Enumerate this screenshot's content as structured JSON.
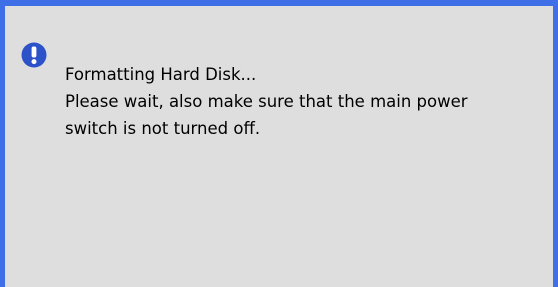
{
  "dialog": {
    "icon": "exclamation-icon",
    "accent_color": "#3f6fe6",
    "background_color": "#dedede",
    "icon_color": "#2b52c9",
    "lines": [
      "Formatting Hard Disk...",
      "Please wait, also make sure that the main power",
      "switch is not turned off."
    ]
  }
}
